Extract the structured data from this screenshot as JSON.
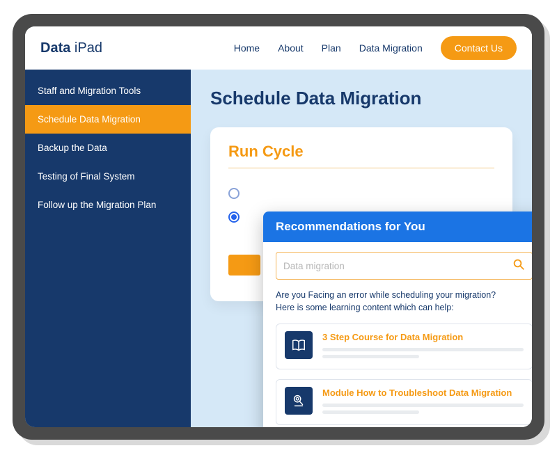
{
  "header": {
    "logo_bold": "Data",
    "logo_rest": " iPad",
    "nav": [
      "Home",
      "About",
      "Plan",
      "Data Migration"
    ],
    "contact_label": "Contact Us"
  },
  "sidebar": {
    "items": [
      {
        "label": "Staff and Migration Tools",
        "active": false
      },
      {
        "label": "Schedule Data Migration",
        "active": true
      },
      {
        "label": "Backup the Data",
        "active": false
      },
      {
        "label": "Testing of Final System",
        "active": false
      },
      {
        "label": "Follow up the Migration Plan",
        "active": false
      }
    ]
  },
  "main": {
    "page_title": "Schedule Data Migration",
    "card_title": "Run Cycle",
    "radio_selected_index": 1
  },
  "popup": {
    "title": "Recommendations for You",
    "search_value": "Data migration",
    "help_line1": "Are you Facing an error while scheduling your migration?",
    "help_line2": "Here is some learning content which can help:",
    "recommendations": [
      {
        "title": "3 Step Course for Data Migration",
        "icon": "book-icon"
      },
      {
        "title": "Module How to Troubleshoot Data Migration",
        "icon": "magnifier-icon"
      }
    ]
  },
  "colors": {
    "accent_orange": "#f59a14",
    "primary_navy": "#17396b",
    "popup_blue": "#1b74e4"
  }
}
